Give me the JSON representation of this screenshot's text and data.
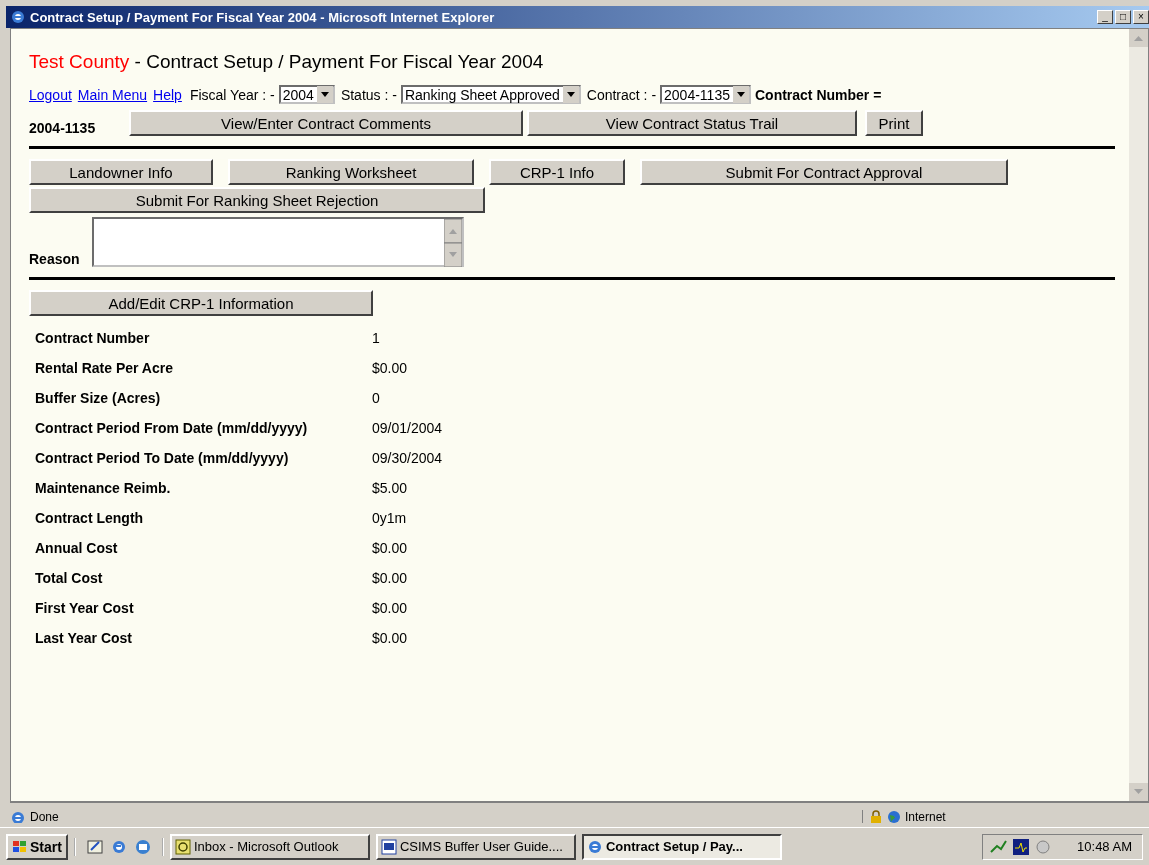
{
  "window": {
    "title": "Contract Setup / Payment For Fiscal Year 2004 - Microsoft Internet Explorer",
    "controls": [
      "_",
      "□",
      "×"
    ]
  },
  "page": {
    "county": "Test County",
    "heading": " - Contract Setup / Payment For Fiscal Year 2004"
  },
  "nav_links": [
    "Logout",
    "Main Menu",
    "Help"
  ],
  "filters": [
    {
      "label": "Fiscal Year : -",
      "value": "2004"
    },
    {
      "label": "Status : -",
      "value": "Ranking Sheet Approved"
    },
    {
      "label": "Contract : -",
      "value": "2004-1135"
    }
  ],
  "contract_number": {
    "label": "Contract Number =",
    "value": "2004-1135"
  },
  "top_buttons": [
    "View/Enter Contract Comments",
    "View Contract Status Trail",
    "Print"
  ],
  "section_buttons": [
    "Landowner Info",
    "Ranking Worksheet",
    "CRP-1 Info",
    "Submit For Contract Approval",
    "Submit For Ranking Sheet Rejection"
  ],
  "reason": {
    "label": "Reason"
  },
  "edit_button": "Add/Edit CRP-1 Information",
  "details": [
    {
      "label": "Contract Number",
      "value": "1"
    },
    {
      "label": "Rental Rate Per Acre",
      "value": "$0.00"
    },
    {
      "label": "Buffer Size (Acres)",
      "value": "0"
    },
    {
      "label": "Contract Period From Date (mm/dd/yyyy)",
      "value": "09/01/2004"
    },
    {
      "label": "Contract Period To Date (mm/dd/yyyy)",
      "value": "09/30/2004"
    },
    {
      "label": "Maintenance Reimb.",
      "value": "$5.00"
    },
    {
      "label": "Contract Length",
      "value": "0y1m"
    },
    {
      "label": "Annual Cost",
      "value": "$0.00"
    },
    {
      "label": "Total Cost",
      "value": "$0.00"
    },
    {
      "label": "First Year Cost",
      "value": "$0.00"
    },
    {
      "label": "Last Year Cost",
      "value": "$0.00"
    }
  ],
  "status_bar": {
    "text": "Done",
    "zone": "Internet"
  },
  "taskbar": {
    "start": "Start",
    "tasks": [
      {
        "label": "Inbox - Microsoft Outlook",
        "selected": false
      },
      {
        "label": "CSIMS Buffer User Guide....",
        "selected": false
      },
      {
        "label": "Contract Setup / Pay...",
        "selected": true
      }
    ],
    "clock": "10:48 AM"
  }
}
